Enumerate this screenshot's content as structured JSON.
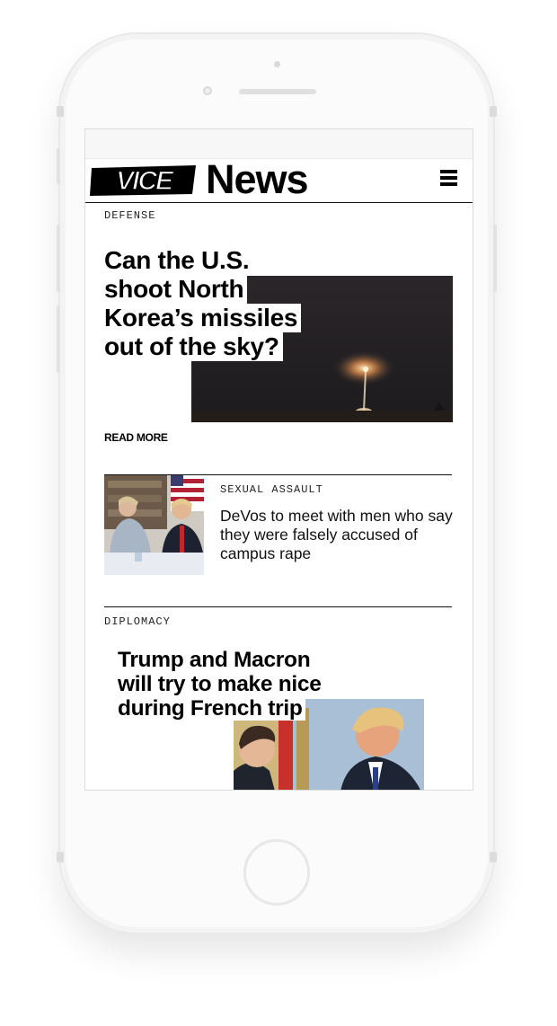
{
  "header": {
    "logo_brand": "VICE",
    "logo_section": "News",
    "menu_icon": "hamburger-menu-icon"
  },
  "stories": [
    {
      "category": "DEFENSE",
      "headline_lines": [
        "Can the U.S.",
        "shoot North",
        "Korea’s missiles",
        "out of the sky?"
      ],
      "read_more": "READ MORE",
      "image": "missile launch at night"
    },
    {
      "category": "SEXUAL ASSAULT",
      "headline": "DeVos to meet with men who say they were falsely accused of campus rape",
      "image": "meeting at a table with flags"
    },
    {
      "category": "DIPLOMACY",
      "headline_lines": [
        "Trump and Macron",
        "will try to make nice",
        "during French trip"
      ],
      "image": "two men in conversation"
    }
  ],
  "colors": {
    "text": "#000000",
    "screen_bg": "#ffffff",
    "phone_bg": "#fbfbfb"
  }
}
